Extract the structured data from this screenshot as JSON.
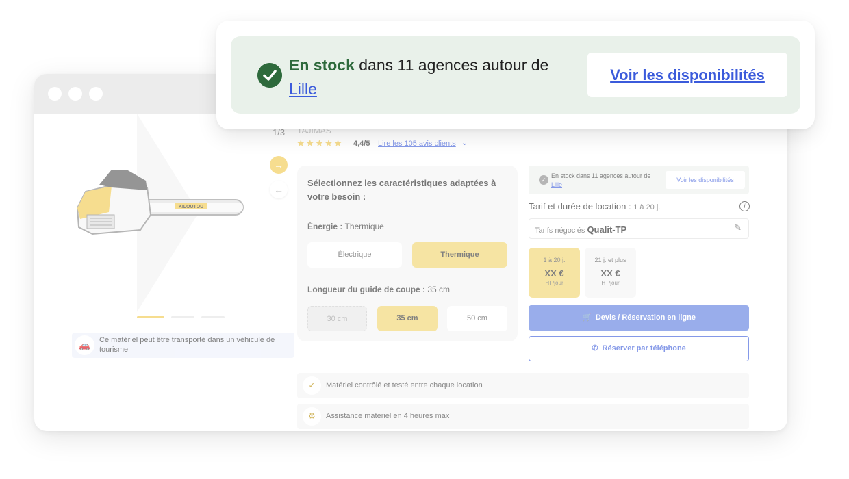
{
  "popup": {
    "stock_status": "En stock",
    "stock_suffix": " dans 11 agences autour de",
    "city": "Lille",
    "cta_label": "Voir les disponibilités"
  },
  "product": {
    "image_counter": "1/3",
    "brand": "TAJIMAS",
    "rating": "4,4/5",
    "reviews_link": "Lire les 105 avis clients",
    "transport_note": "Ce matériel peut être transporté dans un véhicule de tourisme",
    "image_label": "KILOUTOU"
  },
  "config": {
    "title": "Sélectionnez les caractéristiques adaptées à votre besoin :",
    "energy_label": "Énergie :",
    "energy_value": "Thermique",
    "energy_options": [
      "Électrique",
      "Thermique"
    ],
    "length_label": "Longueur du guide de coupe :",
    "length_value": "35 cm",
    "length_options": [
      "30 cm",
      "35 cm",
      "50 cm"
    ]
  },
  "stock_mini": {
    "text": "En stock dans 11 agences autour de",
    "city": "Lille",
    "link": "Voir les disponibilités"
  },
  "pricing": {
    "label": "Tarif et durée de location :",
    "duration": "1 à 20 j.",
    "negotiated_prefix": "Tarifs négociés",
    "negotiated_name": "Qualit-TP",
    "cards": [
      {
        "duration": "1 à 20 j.",
        "price": "XX €",
        "unit": "HT/jour"
      },
      {
        "duration": "21 j. et plus",
        "price": "XX €",
        "unit": "HT/jour"
      }
    ]
  },
  "actions": {
    "quote_label": "Devis / Réservation en ligne",
    "phone_label": "Réserver par téléphone"
  },
  "features": [
    "Matériel contrôlé et testé entre chaque location",
    "Assistance matériel en 4 heures max"
  ],
  "colors": {
    "accent_yellow": "#f2d56b",
    "link_blue": "#3b5bdb",
    "stock_green": "#2e6a3c",
    "cta_blue": "#5b7ce0"
  }
}
